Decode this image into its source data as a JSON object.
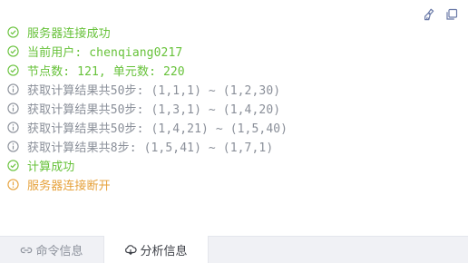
{
  "colors": {
    "success": "#67c23a",
    "info": "#8a8f99",
    "warning": "#e6a23c"
  },
  "toolbar": {
    "icons": [
      "brush-icon",
      "copy-icon"
    ]
  },
  "log": [
    {
      "type": "success",
      "icon": "check-circle-icon",
      "text": "服务器连接成功"
    },
    {
      "type": "success",
      "icon": "check-circle-icon",
      "text": "当前用户: chenqiang0217"
    },
    {
      "type": "success",
      "icon": "check-circle-icon",
      "text": "节点数: 121, 单元数: 220"
    },
    {
      "type": "info",
      "icon": "info-circle-icon",
      "text": "获取计算结果共50步: (1,1,1) ~ (1,2,30)"
    },
    {
      "type": "info",
      "icon": "info-circle-icon",
      "text": "获取计算结果共50步: (1,3,1) ~ (1,4,20)"
    },
    {
      "type": "info",
      "icon": "info-circle-icon",
      "text": "获取计算结果共50步: (1,4,21) ~ (1,5,40)"
    },
    {
      "type": "info",
      "icon": "info-circle-icon",
      "text": "获取计算结果共8步: (1,5,41) ~ (1,7,1)"
    },
    {
      "type": "success",
      "icon": "check-circle-icon",
      "text": "计算成功"
    },
    {
      "type": "warning",
      "icon": "warning-circle-icon",
      "text": "服务器连接断开"
    }
  ],
  "tabs": [
    {
      "label": "命令信息",
      "icon": "link-icon",
      "active": false
    },
    {
      "label": "分析信息",
      "icon": "cloud-icon",
      "active": true
    }
  ]
}
